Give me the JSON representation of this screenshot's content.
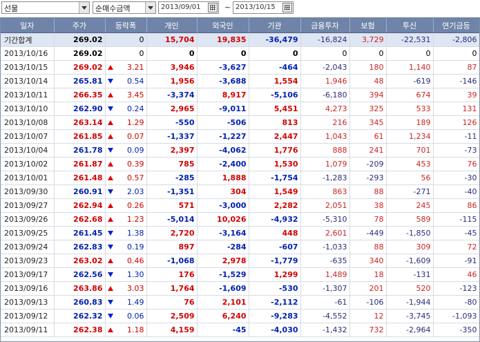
{
  "toolbar": {
    "market": "선물",
    "measure": "순매수금액",
    "start_date": "2013/09/01",
    "separator": "~",
    "end_date": "2013/10/15"
  },
  "columns": [
    "일자",
    "주가",
    "등락폭",
    "개인",
    "외국인",
    "기관",
    "금융투자",
    "보험",
    "투신",
    "연기금등"
  ],
  "total": {
    "label": "기간합계",
    "price": "269.02",
    "change": "0",
    "dir": "none",
    "individual": "15,704",
    "foreign": "19,835",
    "institution": "-36,479",
    "fin_invest": "-16,824",
    "insurance": "3,729",
    "trust": "-22,531",
    "pension": "-2,806"
  },
  "rows": [
    {
      "date": "2013/10/16",
      "price": "269.02",
      "dir": "none",
      "change": "0",
      "individual": "0",
      "foreign": "0",
      "institution": "0",
      "fin_invest": "0",
      "insurance": "0",
      "trust": "0",
      "pension": "0"
    },
    {
      "date": "2013/10/15",
      "price": "269.02",
      "dir": "up",
      "change": "3.21",
      "individual": "3,946",
      "foreign": "-3,627",
      "institution": "-464",
      "fin_invest": "-2,043",
      "insurance": "180",
      "trust": "1,140",
      "pension": "87"
    },
    {
      "date": "2013/10/14",
      "price": "265.81",
      "dir": "down",
      "change": "0.54",
      "individual": "1,956",
      "foreign": "-3,688",
      "institution": "1,554",
      "fin_invest": "1,946",
      "insurance": "48",
      "trust": "-619",
      "pension": "-146"
    },
    {
      "date": "2013/10/11",
      "price": "266.35",
      "dir": "up",
      "change": "3.45",
      "individual": "-3,374",
      "foreign": "8,917",
      "institution": "-5,106",
      "fin_invest": "-6,180",
      "insurance": "394",
      "trust": "674",
      "pension": "39"
    },
    {
      "date": "2013/10/10",
      "price": "262.90",
      "dir": "down",
      "change": "0.24",
      "individual": "2,965",
      "foreign": "-9,011",
      "institution": "5,451",
      "fin_invest": "4,273",
      "insurance": "325",
      "trust": "533",
      "pension": "131"
    },
    {
      "date": "2013/10/08",
      "price": "263.14",
      "dir": "up",
      "change": "1.29",
      "individual": "-550",
      "foreign": "-506",
      "institution": "813",
      "fin_invest": "216",
      "insurance": "345",
      "trust": "189",
      "pension": "126"
    },
    {
      "date": "2013/10/07",
      "price": "261.85",
      "dir": "up",
      "change": "0.07",
      "individual": "-1,337",
      "foreign": "-1,227",
      "institution": "2,447",
      "fin_invest": "1,043",
      "insurance": "61",
      "trust": "1,234",
      "pension": "-11"
    },
    {
      "date": "2013/10/04",
      "price": "261.78",
      "dir": "down",
      "change": "0.09",
      "individual": "2,397",
      "foreign": "-4,062",
      "institution": "1,776",
      "fin_invest": "888",
      "insurance": "241",
      "trust": "701",
      "pension": "-73"
    },
    {
      "date": "2013/10/02",
      "price": "261.87",
      "dir": "up",
      "change": "0.39",
      "individual": "785",
      "foreign": "-2,400",
      "institution": "1,530",
      "fin_invest": "1,079",
      "insurance": "-209",
      "trust": "453",
      "pension": "76"
    },
    {
      "date": "2013/10/01",
      "price": "261.48",
      "dir": "up",
      "change": "0.57",
      "individual": "-285",
      "foreign": "1,888",
      "institution": "-1,754",
      "fin_invest": "-1,283",
      "insurance": "-293",
      "trust": "56",
      "pension": "-30"
    },
    {
      "date": "2013/09/30",
      "price": "260.91",
      "dir": "down",
      "change": "2.03",
      "individual": "-1,351",
      "foreign": "304",
      "institution": "1,549",
      "fin_invest": "863",
      "insurance": "88",
      "trust": "-271",
      "pension": "-40"
    },
    {
      "date": "2013/09/27",
      "price": "262.94",
      "dir": "up",
      "change": "0.26",
      "individual": "571",
      "foreign": "-3,000",
      "institution": "2,282",
      "fin_invest": "2,051",
      "insurance": "38",
      "trust": "245",
      "pension": "86"
    },
    {
      "date": "2013/09/26",
      "price": "262.68",
      "dir": "up",
      "change": "1.23",
      "individual": "-5,014",
      "foreign": "10,026",
      "institution": "-4,932",
      "fin_invest": "-5,310",
      "insurance": "78",
      "trust": "589",
      "pension": "-115"
    },
    {
      "date": "2013/09/25",
      "price": "261.45",
      "dir": "down",
      "change": "1.38",
      "individual": "2,720",
      "foreign": "-3,164",
      "institution": "448",
      "fin_invest": "2,601",
      "insurance": "-449",
      "trust": "-1,850",
      "pension": "-45"
    },
    {
      "date": "2013/09/24",
      "price": "262.83",
      "dir": "down",
      "change": "0.19",
      "individual": "897",
      "foreign": "-284",
      "institution": "-607",
      "fin_invest": "-1,033",
      "insurance": "88",
      "trust": "309",
      "pension": "72"
    },
    {
      "date": "2013/09/23",
      "price": "263.02",
      "dir": "up",
      "change": "0.46",
      "individual": "-1,068",
      "foreign": "2,978",
      "institution": "-1,779",
      "fin_invest": "-635",
      "insurance": "340",
      "trust": "-1,609",
      "pension": "-91"
    },
    {
      "date": "2013/09/17",
      "price": "262.56",
      "dir": "down",
      "change": "1.30",
      "individual": "176",
      "foreign": "-1,529",
      "institution": "1,299",
      "fin_invest": "1,489",
      "insurance": "18",
      "trust": "-131",
      "pension": "46"
    },
    {
      "date": "2013/09/16",
      "price": "263.86",
      "dir": "up",
      "change": "3.03",
      "individual": "1,764",
      "foreign": "-1,609",
      "institution": "-530",
      "fin_invest": "-1,307",
      "insurance": "201",
      "trust": "520",
      "pension": "-123"
    },
    {
      "date": "2013/09/13",
      "price": "260.83",
      "dir": "down",
      "change": "1.49",
      "individual": "76",
      "foreign": "2,101",
      "institution": "-2,112",
      "fin_invest": "-61",
      "insurance": "-106",
      "trust": "-1,944",
      "pension": "-80"
    },
    {
      "date": "2013/09/12",
      "price": "262.32",
      "dir": "down",
      "change": "0.06",
      "individual": "2,509",
      "foreign": "6,240",
      "institution": "-9,283",
      "fin_invest": "-4,552",
      "insurance": "12",
      "trust": "-3,745",
      "pension": "-1,093"
    },
    {
      "date": "2013/09/11",
      "price": "262.38",
      "dir": "up",
      "change": "1.18",
      "individual": "4,159",
      "foreign": "-45",
      "institution": "-4,030",
      "fin_invest": "-1,432",
      "insurance": "732",
      "trust": "-2,964",
      "pension": "-350"
    }
  ],
  "colors": {
    "header_bg": "#6f84a8",
    "up": "#d10000",
    "down": "#0020b0",
    "total_row_bg": "#dfe6f3"
  },
  "icons": {
    "up": "triangle-up-icon",
    "down": "triangle-down-icon",
    "dropdown": "chevron-down-icon",
    "calendar": "calendar-icon"
  }
}
